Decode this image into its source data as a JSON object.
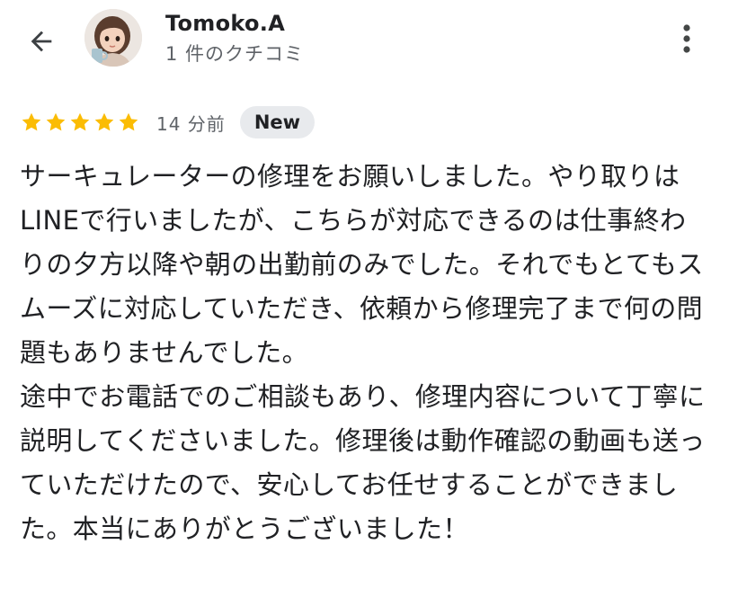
{
  "header": {
    "back_icon": "arrow-left-icon",
    "user_name": "Tomoko.A",
    "review_count": "1 件のクチコミ",
    "menu_icon": "more-vert-icon"
  },
  "review": {
    "rating": 5,
    "rating_max": 5,
    "star_color": "#fbbc04",
    "time_ago": "14 分前",
    "badge": "New",
    "paragraphs": [
      "サーキュレーターの修理をお願いしました。やり取りはLINEで行いましたが、こちらが対応できるのは仕事終わりの夕方以降や朝の出勤前のみでした。それでもとてもスムーズに対応していただき、依頼から修理完了まで何の問題もありませんでした。",
      "途中でお電話でのご相談もあり、修理内容について丁寧に説明してくださいました。修理後は動作確認の動画も送っていただけたので、安心してお任せすることができました。本当にありがとうございました！"
    ]
  }
}
